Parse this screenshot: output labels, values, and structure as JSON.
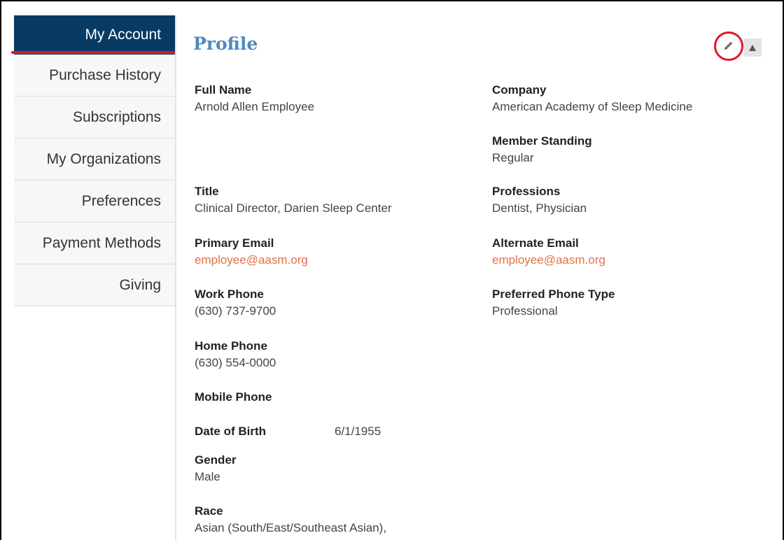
{
  "sidebar": {
    "items": [
      {
        "label": "My Account"
      },
      {
        "label": "Purchase History"
      },
      {
        "label": "Subscriptions"
      },
      {
        "label": "My Organizations"
      },
      {
        "label": "Preferences"
      },
      {
        "label": "Payment Methods"
      },
      {
        "label": "Giving"
      }
    ]
  },
  "profile": {
    "title": "Profile",
    "left": {
      "full_name": {
        "label": "Full Name",
        "value": "Arnold Allen Employee"
      },
      "title": {
        "label": "Title",
        "value": "Clinical Director, Darien Sleep Center"
      },
      "primary_email": {
        "label": "Primary Email",
        "value": "employee@aasm.org"
      },
      "work_phone": {
        "label": "Work Phone",
        "value": "(630) 737-9700"
      },
      "home_phone": {
        "label": "Home Phone",
        "value": "(630) 554-0000"
      },
      "mobile_phone": {
        "label": "Mobile Phone"
      },
      "date_of_birth": {
        "label": "Date of Birth",
        "value": "6/1/1955"
      },
      "gender": {
        "label": "Gender",
        "value": "Male"
      },
      "race": {
        "label": "Race",
        "value": "Asian (South/East/Southeast Asian),"
      }
    },
    "right": {
      "company": {
        "label": "Company",
        "value": "American Academy of Sleep Medicine"
      },
      "member_standing": {
        "label": "Member Standing",
        "value": "Regular"
      },
      "professions": {
        "label": "Professions",
        "value": "Dentist, Physician"
      },
      "alternate_email": {
        "label": "Alternate Email",
        "value": "employee@aasm.org"
      },
      "preferred_phone_type": {
        "label": "Preferred Phone Type",
        "value": "Professional"
      }
    }
  },
  "colors": {
    "nav_active_bg": "#073b63",
    "title_blue": "#4e8ac0",
    "email_link": "#e0714b",
    "highlight_red": "#e0172a"
  }
}
